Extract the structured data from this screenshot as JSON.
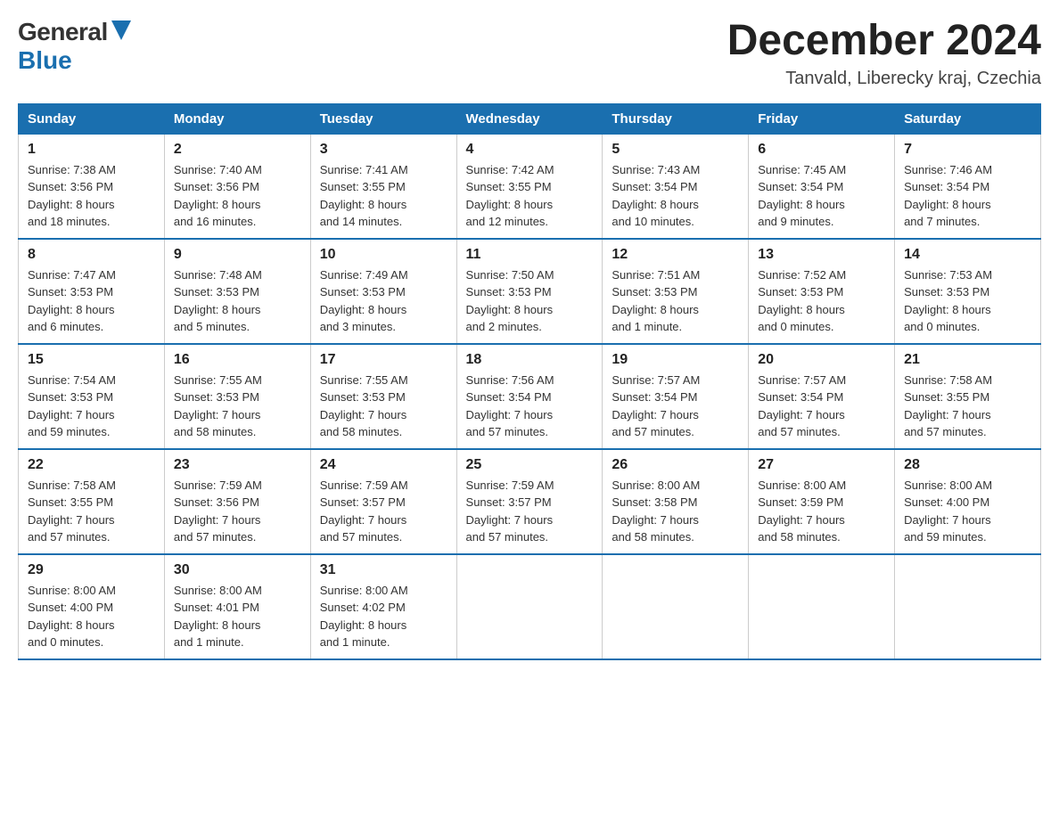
{
  "logo": {
    "general": "General",
    "blue": "Blue"
  },
  "title": "December 2024",
  "location": "Tanvald, Liberecky kraj, Czechia",
  "headers": [
    "Sunday",
    "Monday",
    "Tuesday",
    "Wednesday",
    "Thursday",
    "Friday",
    "Saturday"
  ],
  "weeks": [
    [
      {
        "day": "1",
        "info": "Sunrise: 7:38 AM\nSunset: 3:56 PM\nDaylight: 8 hours\nand 18 minutes."
      },
      {
        "day": "2",
        "info": "Sunrise: 7:40 AM\nSunset: 3:56 PM\nDaylight: 8 hours\nand 16 minutes."
      },
      {
        "day": "3",
        "info": "Sunrise: 7:41 AM\nSunset: 3:55 PM\nDaylight: 8 hours\nand 14 minutes."
      },
      {
        "day": "4",
        "info": "Sunrise: 7:42 AM\nSunset: 3:55 PM\nDaylight: 8 hours\nand 12 minutes."
      },
      {
        "day": "5",
        "info": "Sunrise: 7:43 AM\nSunset: 3:54 PM\nDaylight: 8 hours\nand 10 minutes."
      },
      {
        "day": "6",
        "info": "Sunrise: 7:45 AM\nSunset: 3:54 PM\nDaylight: 8 hours\nand 9 minutes."
      },
      {
        "day": "7",
        "info": "Sunrise: 7:46 AM\nSunset: 3:54 PM\nDaylight: 8 hours\nand 7 minutes."
      }
    ],
    [
      {
        "day": "8",
        "info": "Sunrise: 7:47 AM\nSunset: 3:53 PM\nDaylight: 8 hours\nand 6 minutes."
      },
      {
        "day": "9",
        "info": "Sunrise: 7:48 AM\nSunset: 3:53 PM\nDaylight: 8 hours\nand 5 minutes."
      },
      {
        "day": "10",
        "info": "Sunrise: 7:49 AM\nSunset: 3:53 PM\nDaylight: 8 hours\nand 3 minutes."
      },
      {
        "day": "11",
        "info": "Sunrise: 7:50 AM\nSunset: 3:53 PM\nDaylight: 8 hours\nand 2 minutes."
      },
      {
        "day": "12",
        "info": "Sunrise: 7:51 AM\nSunset: 3:53 PM\nDaylight: 8 hours\nand 1 minute."
      },
      {
        "day": "13",
        "info": "Sunrise: 7:52 AM\nSunset: 3:53 PM\nDaylight: 8 hours\nand 0 minutes."
      },
      {
        "day": "14",
        "info": "Sunrise: 7:53 AM\nSunset: 3:53 PM\nDaylight: 8 hours\nand 0 minutes."
      }
    ],
    [
      {
        "day": "15",
        "info": "Sunrise: 7:54 AM\nSunset: 3:53 PM\nDaylight: 7 hours\nand 59 minutes."
      },
      {
        "day": "16",
        "info": "Sunrise: 7:55 AM\nSunset: 3:53 PM\nDaylight: 7 hours\nand 58 minutes."
      },
      {
        "day": "17",
        "info": "Sunrise: 7:55 AM\nSunset: 3:53 PM\nDaylight: 7 hours\nand 58 minutes."
      },
      {
        "day": "18",
        "info": "Sunrise: 7:56 AM\nSunset: 3:54 PM\nDaylight: 7 hours\nand 57 minutes."
      },
      {
        "day": "19",
        "info": "Sunrise: 7:57 AM\nSunset: 3:54 PM\nDaylight: 7 hours\nand 57 minutes."
      },
      {
        "day": "20",
        "info": "Sunrise: 7:57 AM\nSunset: 3:54 PM\nDaylight: 7 hours\nand 57 minutes."
      },
      {
        "day": "21",
        "info": "Sunrise: 7:58 AM\nSunset: 3:55 PM\nDaylight: 7 hours\nand 57 minutes."
      }
    ],
    [
      {
        "day": "22",
        "info": "Sunrise: 7:58 AM\nSunset: 3:55 PM\nDaylight: 7 hours\nand 57 minutes."
      },
      {
        "day": "23",
        "info": "Sunrise: 7:59 AM\nSunset: 3:56 PM\nDaylight: 7 hours\nand 57 minutes."
      },
      {
        "day": "24",
        "info": "Sunrise: 7:59 AM\nSunset: 3:57 PM\nDaylight: 7 hours\nand 57 minutes."
      },
      {
        "day": "25",
        "info": "Sunrise: 7:59 AM\nSunset: 3:57 PM\nDaylight: 7 hours\nand 57 minutes."
      },
      {
        "day": "26",
        "info": "Sunrise: 8:00 AM\nSunset: 3:58 PM\nDaylight: 7 hours\nand 58 minutes."
      },
      {
        "day": "27",
        "info": "Sunrise: 8:00 AM\nSunset: 3:59 PM\nDaylight: 7 hours\nand 58 minutes."
      },
      {
        "day": "28",
        "info": "Sunrise: 8:00 AM\nSunset: 4:00 PM\nDaylight: 7 hours\nand 59 minutes."
      }
    ],
    [
      {
        "day": "29",
        "info": "Sunrise: 8:00 AM\nSunset: 4:00 PM\nDaylight: 8 hours\nand 0 minutes."
      },
      {
        "day": "30",
        "info": "Sunrise: 8:00 AM\nSunset: 4:01 PM\nDaylight: 8 hours\nand 1 minute."
      },
      {
        "day": "31",
        "info": "Sunrise: 8:00 AM\nSunset: 4:02 PM\nDaylight: 8 hours\nand 1 minute."
      },
      {
        "day": "",
        "info": ""
      },
      {
        "day": "",
        "info": ""
      },
      {
        "day": "",
        "info": ""
      },
      {
        "day": "",
        "info": ""
      }
    ]
  ]
}
